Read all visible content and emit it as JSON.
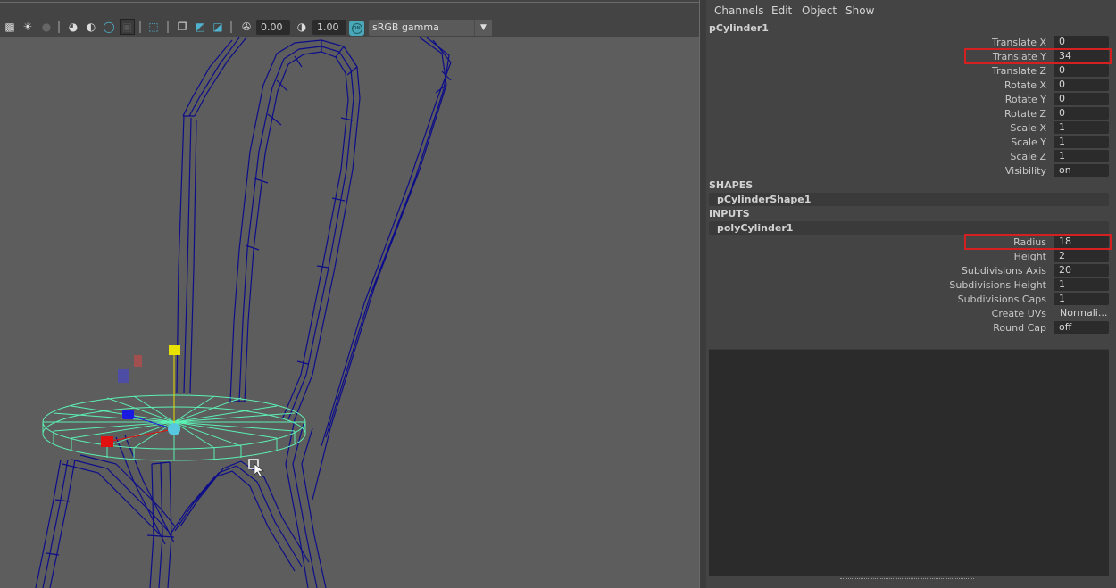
{
  "viewport": {
    "toolbar": {
      "icons": [
        "checker-icon",
        "light-icon",
        "shadow-icon",
        "ambient-occlusion-icon",
        "motion-blur-icon",
        "anti-alias-icon",
        "isolate-select-icon",
        "xray-select-icon",
        "wireframe-shaded-icon",
        "xray-joints-icon",
        "xray-icon",
        "exposure-icon",
        "gamma-icon"
      ],
      "exposure_value": "0.00",
      "gamma_value": "1.00",
      "color_management_badge": "ON",
      "color_space": "sRGB gamma",
      "color_space_arrow": "▼"
    },
    "scene": {
      "object_wireframe_color": "#0d0d8a",
      "selected_wireframe_color": "#5cf0b4",
      "background_color": "#5d5d5d",
      "manipulator_colors": {
        "x": "#e01010",
        "y": "#e8e000",
        "z": "#1a1ae0",
        "center": "#58c8e0"
      }
    }
  },
  "channel_box": {
    "menu": [
      "Channels",
      "Edit",
      "Object",
      "Show"
    ],
    "node_name": "pCylinder1",
    "transform_attrs": [
      {
        "label": "Translate X",
        "value": "0"
      },
      {
        "label": "Translate Y",
        "value": "34",
        "highlighted": true
      },
      {
        "label": "Translate Z",
        "value": "0"
      },
      {
        "label": "Rotate X",
        "value": "0"
      },
      {
        "label": "Rotate Y",
        "value": "0"
      },
      {
        "label": "Rotate Z",
        "value": "0"
      },
      {
        "label": "Scale X",
        "value": "1"
      },
      {
        "label": "Scale Y",
        "value": "1"
      },
      {
        "label": "Scale Z",
        "value": "1"
      },
      {
        "label": "Visibility",
        "value": "on"
      }
    ],
    "shapes_header": "SHAPES",
    "shape_node": "pCylinderShape1",
    "inputs_header": "INPUTS",
    "input_node": "polyCylinder1",
    "input_attrs": [
      {
        "label": "Radius",
        "value": "18",
        "highlighted": true
      },
      {
        "label": "Height",
        "value": "2"
      },
      {
        "label": "Subdivisions Axis",
        "value": "20"
      },
      {
        "label": "Subdivisions Height",
        "value": "1"
      },
      {
        "label": "Subdivisions Caps",
        "value": "1"
      },
      {
        "label": "Create UVs",
        "value": "Normali..."
      },
      {
        "label": "Round Cap",
        "value": "off"
      }
    ],
    "highlight_color": "#d42020"
  }
}
